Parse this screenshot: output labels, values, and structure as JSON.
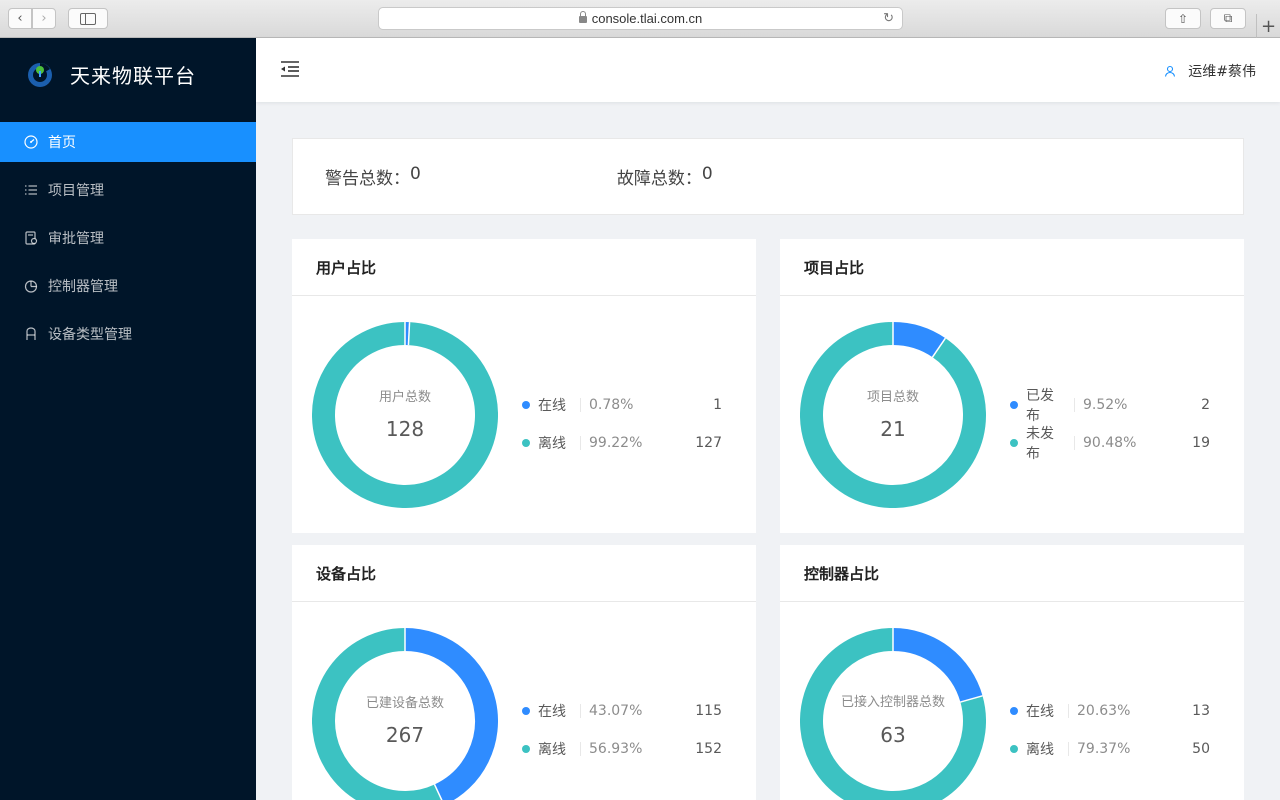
{
  "browser": {
    "url": "console.tlai.com.cn"
  },
  "sidebar": {
    "title": "天来物联平台",
    "items": [
      {
        "label": "首页",
        "icon": "dashboard-icon",
        "active": true
      },
      {
        "label": "项目管理",
        "icon": "list-icon",
        "active": false
      },
      {
        "label": "审批管理",
        "icon": "audit-icon",
        "active": false
      },
      {
        "label": "控制器管理",
        "icon": "pie-chart-icon",
        "active": false
      },
      {
        "label": "设备类型管理",
        "icon": "device-icon",
        "active": false
      }
    ]
  },
  "header": {
    "user": "运维#蔡伟"
  },
  "stats": {
    "warning_label": "警告总数：",
    "warning_value": "0",
    "fault_label": "故障总数：",
    "fault_value": "0"
  },
  "colors": {
    "primary": "#1890ff",
    "series_blue": "#2f8cff",
    "series_teal": "#3cc2c2",
    "sidebar_bg": "#001529"
  },
  "cards": [
    {
      "title": "用户占比",
      "center_label": "用户总数",
      "center_value": "128",
      "legend": [
        {
          "name": "在线",
          "pct": "0.78%",
          "value": "1",
          "color": "#2f8cff"
        },
        {
          "name": "离线",
          "pct": "99.22%",
          "value": "127",
          "color": "#3cc2c2"
        }
      ]
    },
    {
      "title": "项目占比",
      "center_label": "项目总数",
      "center_value": "21",
      "legend": [
        {
          "name": "已发布",
          "pct": "9.52%",
          "value": "2",
          "color": "#2f8cff"
        },
        {
          "name": "未发布",
          "pct": "90.48%",
          "value": "19",
          "color": "#3cc2c2"
        }
      ]
    },
    {
      "title": "设备占比",
      "center_label": "已建设备总数",
      "center_value": "267",
      "legend": [
        {
          "name": "在线",
          "pct": "43.07%",
          "value": "115",
          "color": "#2f8cff"
        },
        {
          "name": "离线",
          "pct": "56.93%",
          "value": "152",
          "color": "#3cc2c2"
        }
      ]
    },
    {
      "title": "控制器占比",
      "center_label": "已接入控制器总数",
      "center_value": "63",
      "legend": [
        {
          "name": "在线",
          "pct": "20.63%",
          "value": "13",
          "color": "#2f8cff"
        },
        {
          "name": "离线",
          "pct": "79.37%",
          "value": "50",
          "color": "#3cc2c2"
        }
      ]
    }
  ]
}
